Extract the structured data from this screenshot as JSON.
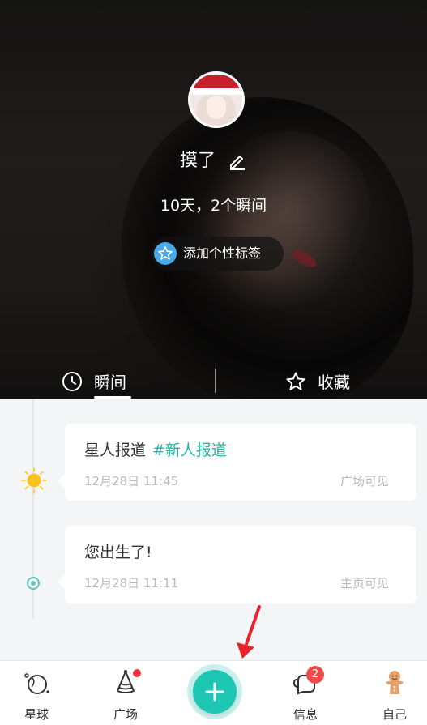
{
  "profile": {
    "username": "摸了",
    "stats": "10天，2个瞬间",
    "tag_button_label": "添加个性标签"
  },
  "tabs": [
    {
      "label": "瞬间",
      "icon": "clock-icon",
      "active": true
    },
    {
      "label": "收藏",
      "icon": "star-icon",
      "active": false
    }
  ],
  "timeline": [
    {
      "text": "星人报道",
      "hashtag": "#新人报道",
      "time": "12月28日 11:45",
      "visibility": "广场可见",
      "marker": "sun-icon"
    },
    {
      "text": "您出生了!",
      "time": "12月28日 11:11",
      "visibility": "主页可见",
      "marker": "dot-icon"
    }
  ],
  "bottom_nav": {
    "items": [
      {
        "label": "星球",
        "icon": "planet-icon"
      },
      {
        "label": "广场",
        "icon": "square-icon",
        "has_dot": true
      },
      {
        "label": "信息",
        "icon": "messages-icon",
        "badge": "2"
      },
      {
        "label": "自己",
        "icon": "me-icon"
      }
    ],
    "fab_icon": "plus-icon"
  },
  "colors": {
    "accent": "#1dc7b3",
    "hashtag": "#21b7a6",
    "badge": "#f04b4b",
    "annotation_arrow": "#e8232a"
  }
}
